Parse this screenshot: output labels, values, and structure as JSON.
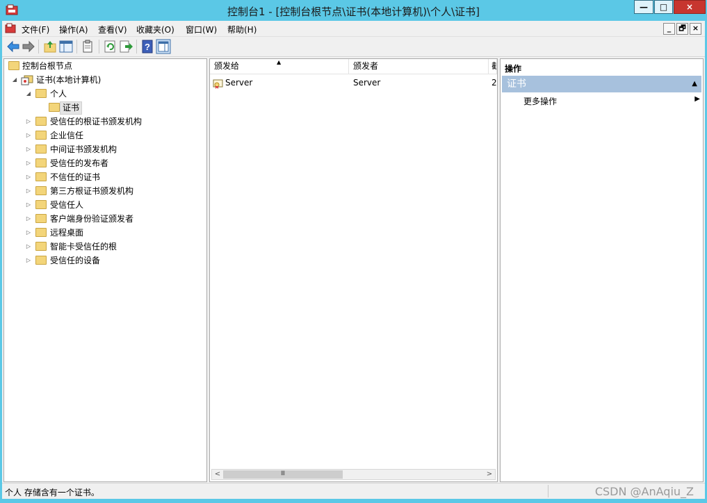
{
  "window": {
    "title": "控制台1 - [控制台根节点\\证书(本地计算机)\\个人\\证书]",
    "minimize": "—",
    "maximize": "□",
    "close": "×"
  },
  "menubar": {
    "items": [
      "文件(F)",
      "操作(A)",
      "查看(V)",
      "收藏夹(O)",
      "窗口(W)",
      "帮助(H)"
    ],
    "mdi_minimize": "_",
    "mdi_restore": "🗗",
    "mdi_close": "×"
  },
  "toolbar": {
    "icons": [
      "back-arrow-icon",
      "forward-arrow-icon",
      "up-folder-icon",
      "show-tree-icon",
      "properties-icon",
      "refresh-icon",
      "export-list-icon",
      "help-icon",
      "show-action-pane-icon"
    ]
  },
  "tree": {
    "root": "控制台根节点",
    "certs_local": "证书(本地计算机)",
    "personal": "个人",
    "selected": "证书",
    "stores": [
      "受信任的根证书颁发机构",
      "企业信任",
      "中间证书颁发机构",
      "受信任的发布者",
      "不信任的证书",
      "第三方根证书颁发机构",
      "受信任人",
      "客户端身份验证颁发者",
      "远程桌面",
      "智能卡受信任的根",
      "受信任的设备"
    ]
  },
  "list": {
    "columns": [
      "颁发给",
      "颁发者",
      "截"
    ],
    "rows": [
      {
        "issued_to": "Server",
        "issued_by": "Server",
        "expires": "2"
      }
    ],
    "scroll_thumb": "Ⅲ"
  },
  "actions": {
    "title": "操作",
    "section": "证书",
    "more": "更多操作"
  },
  "status": {
    "text": "个人 存储含有一个证书。"
  },
  "watermark": "CSDN @AnAqiu_Z",
  "colors": {
    "titlebar": "#5bc8e6",
    "action_section": "#a7c1dd",
    "folder": "#f3d57a"
  }
}
